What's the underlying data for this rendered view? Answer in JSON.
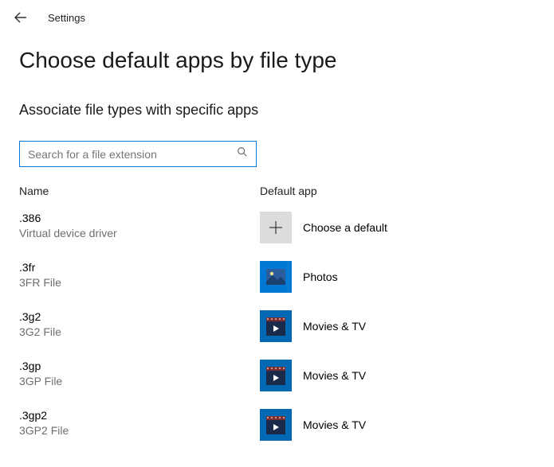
{
  "header": {
    "app_title": "Settings"
  },
  "page": {
    "title": "Choose default apps by file type",
    "subtitle": "Associate file types with specific apps"
  },
  "search": {
    "placeholder": "Search for a file extension",
    "value": ""
  },
  "columns": {
    "name": "Name",
    "app": "Default app"
  },
  "apps": {
    "choose": "Choose a default",
    "photos": "Photos",
    "movies": "Movies & TV"
  },
  "rows": [
    {
      "ext": ".386",
      "desc": "Virtual device driver",
      "app_key": "choose",
      "icon": "plus"
    },
    {
      "ext": ".3fr",
      "desc": "3FR File",
      "app_key": "photos",
      "icon": "photos"
    },
    {
      "ext": ".3g2",
      "desc": "3G2 File",
      "app_key": "movies",
      "icon": "movies"
    },
    {
      "ext": ".3gp",
      "desc": "3GP File",
      "app_key": "movies",
      "icon": "movies"
    },
    {
      "ext": ".3gp2",
      "desc": "3GP2 File",
      "app_key": "movies",
      "icon": "movies"
    }
  ]
}
